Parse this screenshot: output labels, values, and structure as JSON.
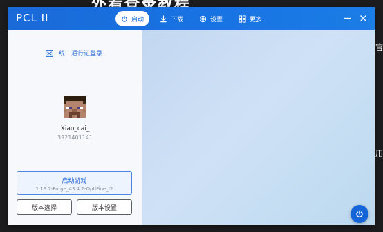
{
  "background": {
    "title": "外看登录教程",
    "side_text_1": "戏官",
    "side_text_2": "使用"
  },
  "window": {
    "app_title": "PCL II",
    "nav": [
      {
        "label": "启动",
        "icon": "power-icon",
        "active": true
      },
      {
        "label": "下载",
        "icon": "download-icon",
        "active": false
      },
      {
        "label": "设置",
        "icon": "gear-icon",
        "active": false
      },
      {
        "label": "更多",
        "icon": "grid-icon",
        "active": false
      }
    ],
    "controls": [
      "minimize-icon",
      "close-icon"
    ]
  },
  "left_panel": {
    "login_link": "统一通行证登录",
    "player_name": "Xiao_cai_",
    "player_id": "3921401141",
    "launch_button": {
      "label": "启动游戏",
      "version": "1.19.2-Forge_43.4.2-OptiFine_I2"
    },
    "version_select_button": "版本选择",
    "version_settings_button": "版本设置"
  },
  "colors": {
    "accent": "#1a6ad8",
    "titlebar": "#1873e2",
    "right_panel": "#c8dcf3"
  }
}
